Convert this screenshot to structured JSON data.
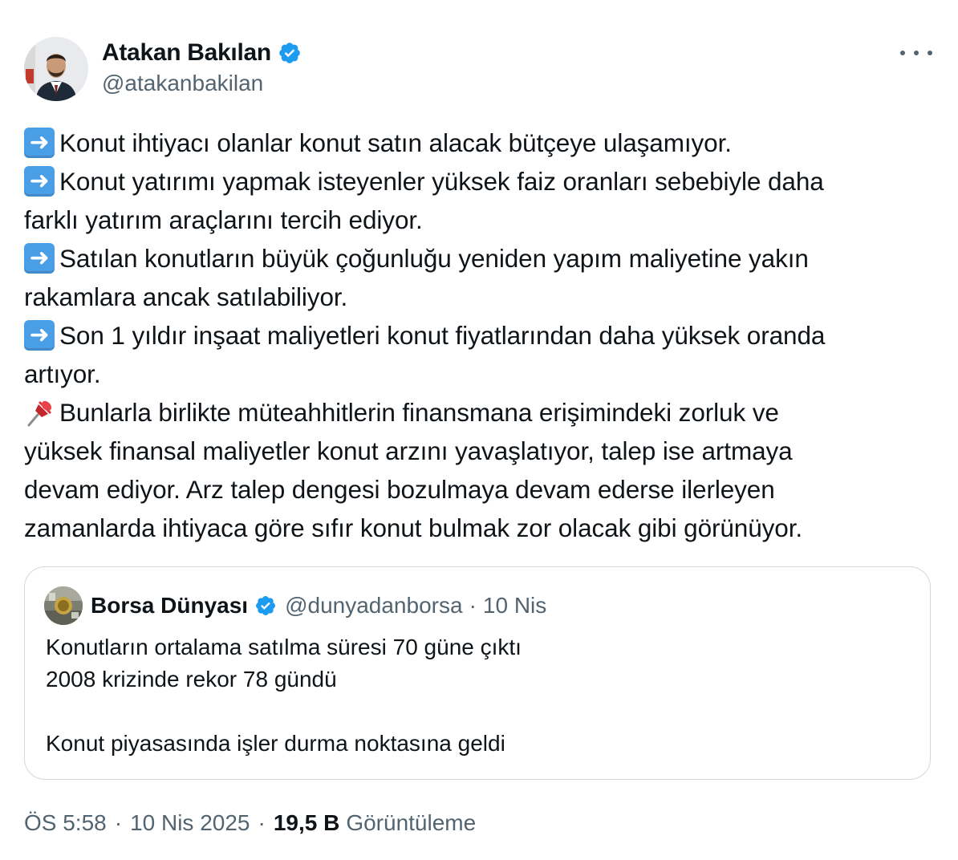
{
  "author": {
    "display_name": "Atakan Bakılan",
    "handle": "@atakanbakilan",
    "verified": true
  },
  "tweet": {
    "lines": [
      {
        "emoji": "arrow-right",
        "text": "Konut ihtiyacı olanlar konut satın alacak bütçeye ulaşamıyor."
      },
      {
        "emoji": "arrow-right",
        "text": "Konut yatırımı yapmak isteyenler yüksek faiz oranları sebebiyle daha"
      },
      {
        "emoji": "",
        "text": "farklı yatırım araçlarını tercih ediyor."
      },
      {
        "emoji": "arrow-right",
        "text": "Satılan konutların büyük çoğunluğu yeniden yapım maliyetine yakın"
      },
      {
        "emoji": "",
        "text": "rakamlara ancak satılabiliyor."
      },
      {
        "emoji": "arrow-right",
        "text": "Son 1 yıldır inşaat maliyetleri konut fiyatlarından daha yüksek oranda"
      },
      {
        "emoji": "",
        "text": "artıyor."
      },
      {
        "emoji": "pushpin",
        "text": "Bunlarla birlikte müteahhitlerin finansmana erişimindeki zorluk ve"
      },
      {
        "emoji": "",
        "text": "yüksek finansal maliyetler konut arzını yavaşlatıyor, talep ise artmaya"
      },
      {
        "emoji": "",
        "text": "devam ediyor. Arz talep dengesi bozulmaya devam ederse ilerleyen"
      },
      {
        "emoji": "",
        "text": "zamanlarda ihtiyaca göre sıfır konut bulmak zor olacak gibi görünüyor."
      }
    ]
  },
  "quote": {
    "display_name": "Borsa Dünyası",
    "handle": "@dunyadanborsa",
    "separator": "·",
    "date": "10 Nis",
    "verified": true,
    "lines": [
      "Konutların ortalama satılma süresi 70 güne çıktı",
      "2008 krizinde rekor 78 gündü",
      "",
      "Konut piyasasında işler durma noktasına geldi"
    ]
  },
  "meta": {
    "time": "ÖS 5:58",
    "separator": "·",
    "date": "10 Nis 2025",
    "views_count": "19,5 B",
    "views_label": "Görüntüleme"
  },
  "colors": {
    "text": "#0f1419",
    "secondary": "#536471",
    "verified": "#1d9bf0",
    "border": "#cfd9de",
    "arrow_emoji_bg": "#4a9ee6"
  },
  "icons": {
    "more": "more-horizontal-icon",
    "verified": "verified-badge-icon",
    "arrow": "arrow-right-emoji-icon",
    "pin": "pushpin-emoji-icon"
  }
}
